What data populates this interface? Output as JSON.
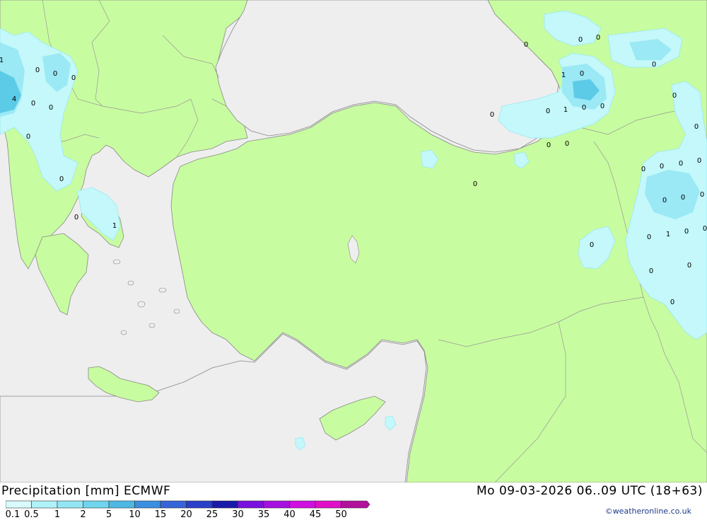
{
  "title": "Precipitation [mm] ECMWF",
  "datetime": "Mo 09-03-2026 06..09 UTC (18+63)",
  "credit": "©weatheronline.co.uk",
  "colors": {
    "land": "#c8fca0",
    "sea": "#eeeeee",
    "border": "#999999",
    "coast": "#888888",
    "precip_light": "#c4f8fa",
    "precip_medium": "#9ae9f5",
    "precip_heavy": "#5ccbe8"
  },
  "legend": {
    "labels": [
      "0.1",
      "0.5",
      "1",
      "2",
      "5",
      "10",
      "15",
      "20",
      "25",
      "30",
      "35",
      "40",
      "45",
      "50"
    ],
    "colors": [
      "#d9fbfd",
      "#b0f2f8",
      "#93e6f3",
      "#6fd5ec",
      "#4db8e3",
      "#3a8fe0",
      "#3565d8",
      "#2a40c8",
      "#1a1aa8",
      "#7a10e0",
      "#a510e0",
      "#d010e0",
      "#e010c8",
      "#b0109a"
    ]
  },
  "precip_values": [
    "1",
    "4",
    "0",
    "0",
    "0",
    "0",
    "0",
    "0",
    "0",
    "0",
    "1",
    "0",
    "0",
    "0",
    "0",
    "0",
    "0",
    "0",
    "1",
    "0",
    "0",
    "0",
    "1",
    "0",
    "0",
    "0",
    "0",
    "0",
    "0",
    "0",
    "0",
    "0",
    "0",
    "0",
    "0",
    "1",
    "0",
    "0",
    "0",
    "0",
    "0",
    "0",
    "1",
    "0",
    "0",
    "0"
  ]
}
